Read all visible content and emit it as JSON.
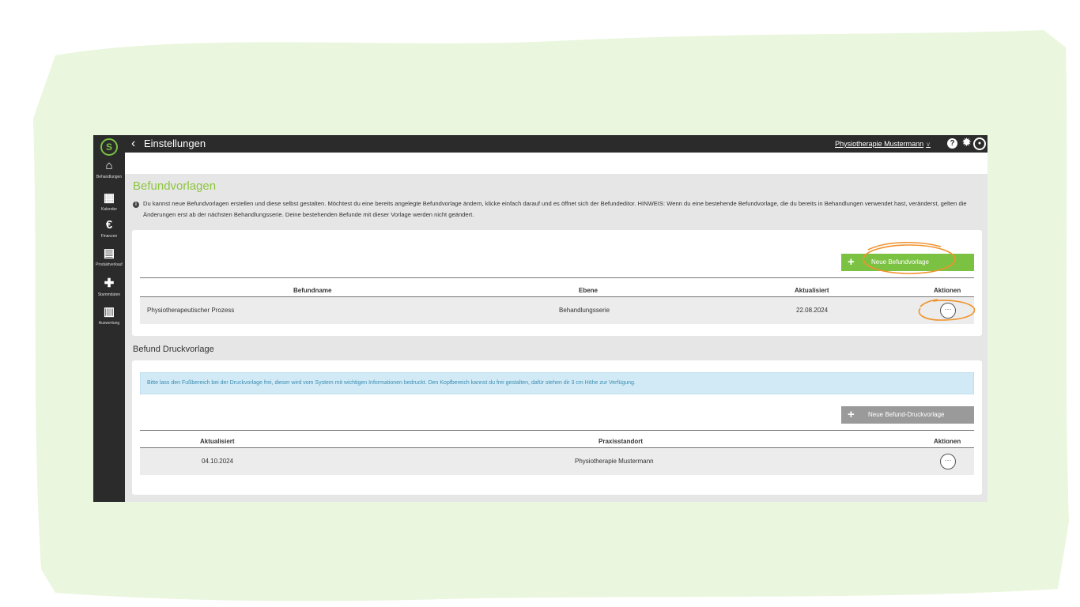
{
  "colors": {
    "accent": "#8dc63f",
    "button_green": "#7cc242",
    "annotation": "#f0922c",
    "background_blob": "#eaf6dd"
  },
  "sidebar": {
    "logo": "S",
    "items": [
      {
        "icon": "home-icon",
        "glyph": "⌂",
        "label": "Behandlungen"
      },
      {
        "icon": "calendar-icon",
        "glyph": "▦",
        "label": "Kalender"
      },
      {
        "icon": "euro-icon",
        "glyph": "€",
        "label": "Finanzen"
      },
      {
        "icon": "document-icon",
        "glyph": "▤",
        "label": "Produktverkauf"
      },
      {
        "icon": "puzzle-icon",
        "glyph": "✚",
        "label": "Stammdaten"
      },
      {
        "icon": "chart-icon",
        "glyph": "▥",
        "label": "Auswertung"
      }
    ]
  },
  "topbar": {
    "title": "Einstellungen",
    "practice": "Physiotherapie Mustermann",
    "help_glyph": "?",
    "gear_glyph": "✹",
    "user_glyph": "●"
  },
  "befundvorlagen": {
    "title": "Befundvorlagen",
    "info": "Du kannst neue Befundvorlagen erstellen und diese selbst gestalten. Möchtest du eine bereits angelegte Befundvorlage ändern, klicke einfach darauf und es öffnet sich der Befundeditor. HINWEIS: Wenn du eine bestehende Befundvorlage, die du bereits in Behandlungen verwendet hast, veränderst, gelten die Änderungen erst ab der nächsten Behandlungsserie. Deine bestehenden Befunde mit dieser Vorlage werden nicht geändert.",
    "new_button": "Neue Befundvorlage",
    "columns": [
      "Befundname",
      "Ebene",
      "Aktualisiert",
      "Aktionen"
    ],
    "rows": [
      {
        "name": "Physiotherapeutischer Prozess",
        "ebene": "Behandlungsserie",
        "aktualisiert": "22.08.2024",
        "actions": "···"
      }
    ]
  },
  "druckvorlage": {
    "title": "Befund Druckvorlage",
    "alert": "Bitte lass den Fußbereich bei der Druckvorlage frei, dieser wird vom System mit wichtigen Informationen bedruckt. Den Kopfbereich kannst du frei gestalten, dafür stehen dir 3 cm Höhe zur Verfügung.",
    "new_button": "Neue Befund-Druckvorlage",
    "columns": [
      "Aktualisiert",
      "Praxisstandort",
      "Aktionen"
    ],
    "rows": [
      {
        "aktualisiert": "04.10.2024",
        "standort": "Physiotherapie Mustermann",
        "actions": "···"
      }
    ]
  },
  "plus_glyph": "+"
}
